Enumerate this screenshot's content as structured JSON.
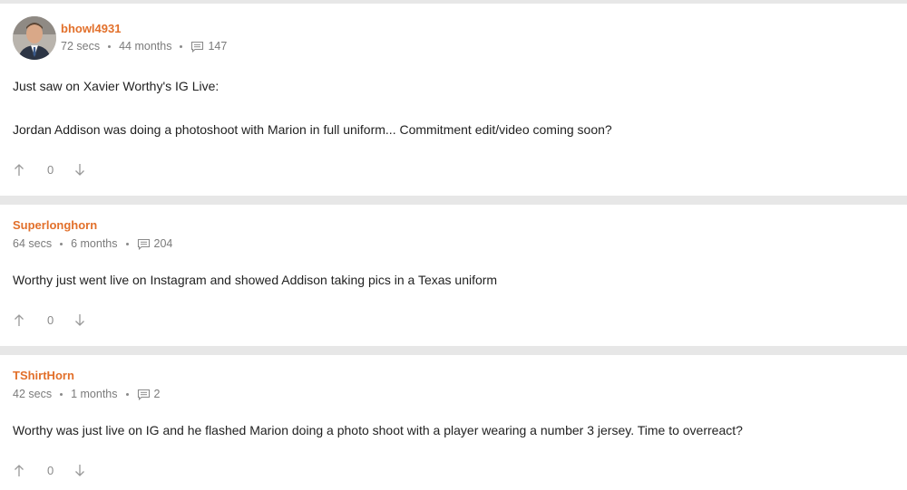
{
  "posts": [
    {
      "username": "bhowl4931",
      "time": "72 secs",
      "tenure": "44 months",
      "comment_count": "147",
      "has_avatar": true,
      "body": [
        "Just saw on Xavier Worthy's IG Live:",
        "Jordan Addison was doing a photoshoot with Marion in full uniform... Commitment edit/video coming soon?"
      ],
      "votes": "0"
    },
    {
      "username": "Superlonghorn",
      "time": "64 secs",
      "tenure": "6 months",
      "comment_count": "204",
      "has_avatar": false,
      "body": [
        "Worthy just went live on Instagram and showed Addison taking pics in a Texas uniform"
      ],
      "votes": "0"
    },
    {
      "username": "TShirtHorn",
      "time": "42 secs",
      "tenure": "1 months",
      "comment_count": "2",
      "has_avatar": false,
      "body": [
        "Worthy was just live on IG and he flashed Marion doing a photo shoot with a player wearing a number 3 jersey. Time to overreact?"
      ],
      "votes": "0"
    }
  ],
  "colors": {
    "username": "#e2702b",
    "meta": "#7b7b7b",
    "background": "#e7e7e7"
  },
  "icons": {
    "comment": "comment-icon",
    "upvote": "arrow-up-icon",
    "downvote": "arrow-down-icon"
  }
}
